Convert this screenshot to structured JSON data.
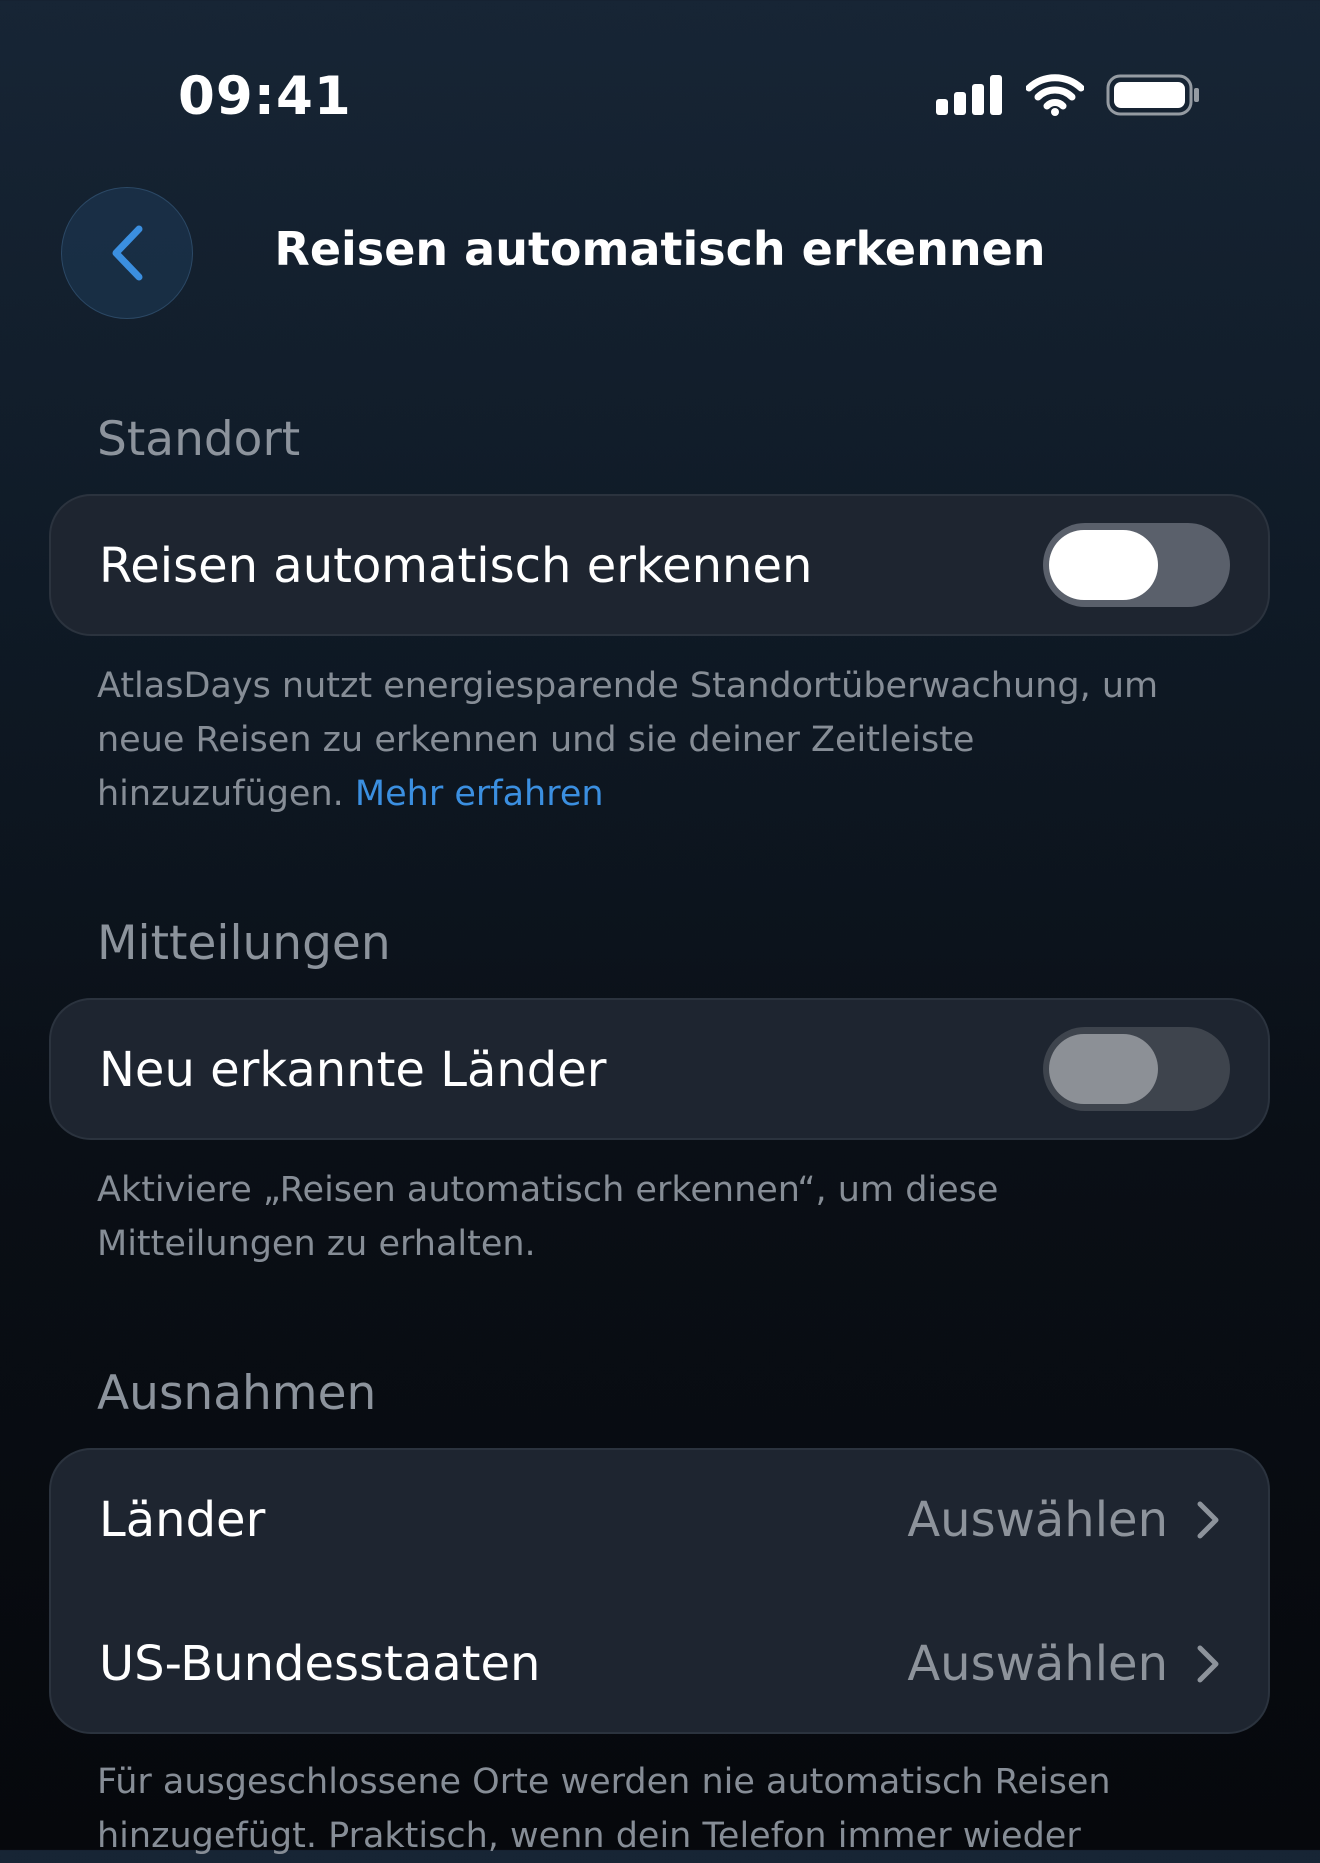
{
  "status_bar": {
    "time": "09:41",
    "icons": [
      "cellular-signal-icon",
      "wifi-icon",
      "battery-icon"
    ]
  },
  "nav": {
    "back_icon": "chevron-left-icon",
    "title": "Reisen automatisch erkennen"
  },
  "sections": {
    "location": {
      "header": "Standort",
      "row_label": "Reisen automatisch erkennen",
      "toggle_on": false,
      "footer_text": "AtlasDays nutzt energiesparende Standortüberwachung, um neue Reisen zu erkennen und sie deiner Zeitleiste hinzuzufügen.",
      "footer_link": "Mehr erfahren"
    },
    "notifications": {
      "header": "Mitteilungen",
      "row_label": "Neu erkannte Länder",
      "toggle_on": false,
      "toggle_disabled": true,
      "footer_text": "Aktiviere „Reisen automatisch erkennen“, um diese Mitteilungen zu erhalten."
    },
    "exceptions": {
      "header": "Ausnahmen",
      "rows": [
        {
          "label": "Länder",
          "value": "Auswählen"
        },
        {
          "label": "US-Bundesstaaten",
          "value": "Auswählen"
        }
      ],
      "footer_text": "Für ausgeschlossene Orte werden nie automatisch Reisen hinzugefügt. Praktisch, wenn dein Telefon immer wieder"
    }
  },
  "colors": {
    "accent": "#3b8fe0",
    "card_background": "#1e2530",
    "secondary_text": "#8c939c"
  }
}
